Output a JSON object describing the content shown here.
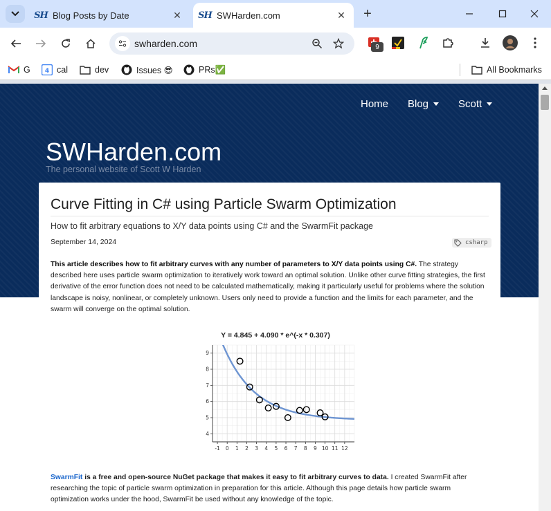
{
  "browser": {
    "tabs": [
      {
        "title": "Blog Posts by Date",
        "favicon": "SH",
        "active": false
      },
      {
        "title": "SWHarden.com",
        "favicon": "SH",
        "active": true
      }
    ],
    "new_tab_label": "+",
    "address": "swharden.com",
    "extension_badge": "9",
    "bookmarks": [
      {
        "label": "G",
        "icon": "gmail-icon"
      },
      {
        "label": "cal",
        "icon": "calendar-icon",
        "icon_text": "4"
      },
      {
        "label": "dev",
        "icon": "folder-icon"
      },
      {
        "label": "Issues 😎",
        "icon": "github-icon"
      },
      {
        "label": "PRs✅",
        "icon": "github-icon"
      }
    ],
    "all_bookmarks_label": "All Bookmarks"
  },
  "site": {
    "nav": [
      {
        "label": "Home",
        "has_caret": false
      },
      {
        "label": "Blog",
        "has_caret": true
      },
      {
        "label": "Scott",
        "has_caret": true
      }
    ],
    "title": "SWHarden.com",
    "tagline": "The personal website of Scott W Harden",
    "header_color": "#0a2c5c"
  },
  "article": {
    "title": "Curve Fitting in C# using Particle Swarm Optimization",
    "subtitle": "How to fit arbitrary equations to X/Y data points using C# and the SwarmFit package",
    "date": "September 14, 2024",
    "tag": "csharp",
    "intro_bold": "This article describes how to fit arbitrary curves with any number of parameters to X/Y data points using C#.",
    "intro_rest": " The strategy described here uses particle swarm optimization to iteratively work toward an optimal solution. Unlike other curve fitting strategies, the first derivative of the error function does not need to be calculated mathematically, making it particularly useful for problems where the solution landscape is noisy, nonlinear, or completely unknown. Users only need to provide a function and the limits for each parameter, and the swarm will converge on the optimal solution.",
    "p2_link": "SwarmFit",
    "p2_bold": " is a free and open-source NuGet package that makes it easy to fit arbitrary curves to data.",
    "p2_rest": " I created SwarmFit after researching the topic of particle swarm optimization in preparation for this article. Although this page details how particle swarm optimization works under the hood, SwarmFit be used without any knowledge of the topic."
  },
  "chart_data": {
    "type": "scatter",
    "title": "Y = 4.845 + 4.090 * e^(-x * 0.307)",
    "xlabel": "",
    "ylabel": "",
    "xlim": [
      -1.5,
      13
    ],
    "ylim": [
      3.5,
      9.5
    ],
    "xticks": [
      -1,
      0,
      1,
      2,
      3,
      4,
      5,
      6,
      7,
      8,
      9,
      10,
      11,
      12
    ],
    "yticks": [
      4,
      5,
      6,
      7,
      8,
      9
    ],
    "grid": true,
    "points": [
      {
        "x": 1.3,
        "y": 8.5
      },
      {
        "x": 2.3,
        "y": 6.9
      },
      {
        "x": 3.3,
        "y": 6.1
      },
      {
        "x": 4.2,
        "y": 5.6
      },
      {
        "x": 5.0,
        "y": 5.7
      },
      {
        "x": 6.2,
        "y": 5.0
      },
      {
        "x": 7.4,
        "y": 5.45
      },
      {
        "x": 8.1,
        "y": 5.5
      },
      {
        "x": 9.5,
        "y": 5.3
      },
      {
        "x": 10.0,
        "y": 5.05
      }
    ],
    "fit": {
      "a": 4.845,
      "b": 4.09,
      "c": 0.307
    },
    "fit_color": "#6e95d2",
    "marker_color": "#000000"
  }
}
